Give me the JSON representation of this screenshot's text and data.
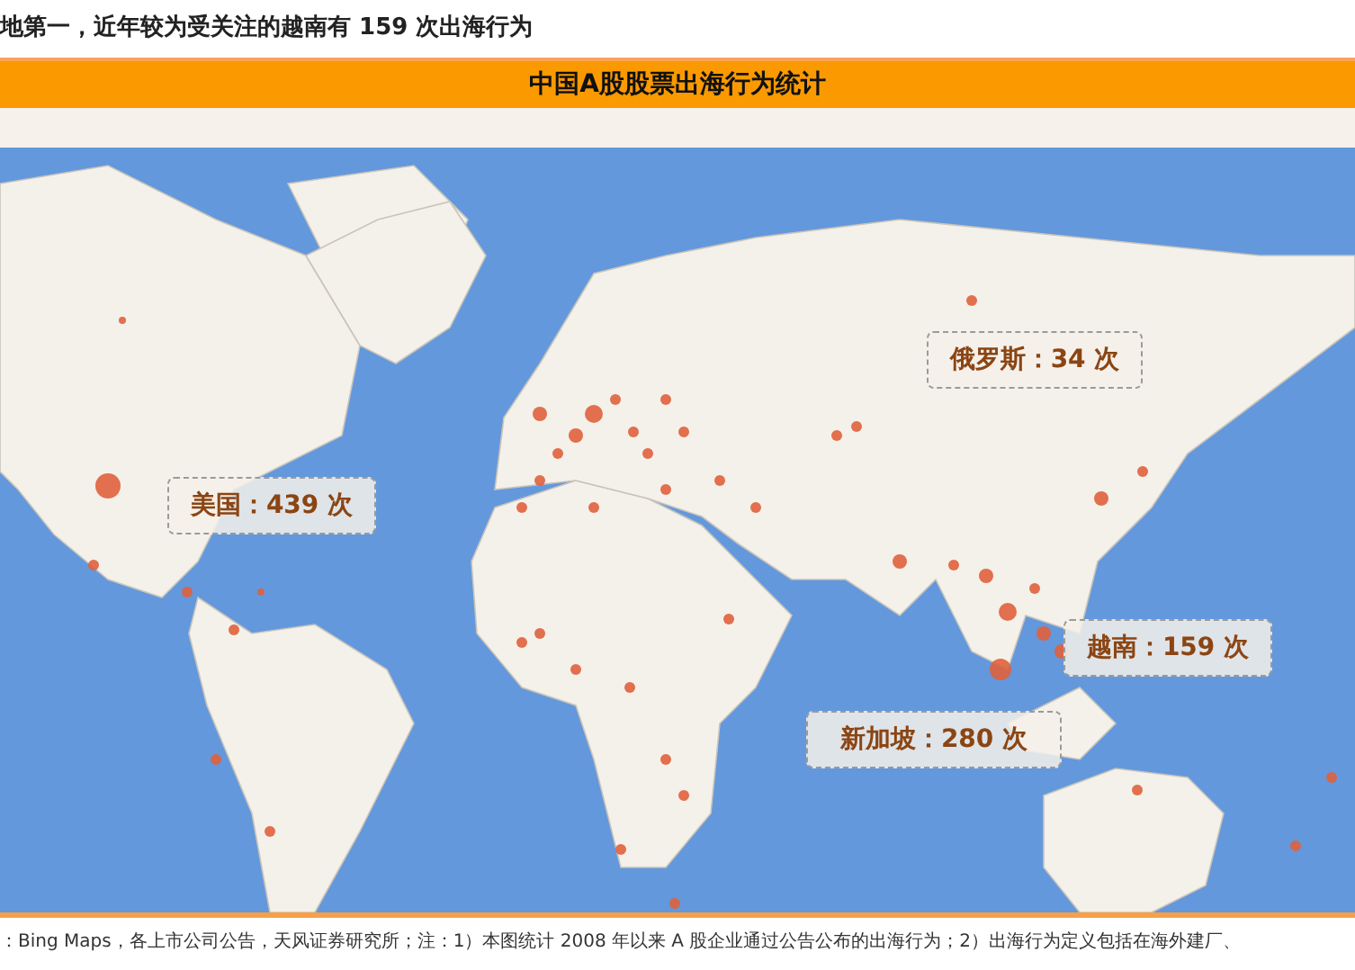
{
  "caption": "地第一，近年较为受关注的越南有 159 次出海行为",
  "title_bar": {
    "title": "中国A股股票出海行为统计"
  },
  "map": {
    "callouts": [
      {
        "label": "美国：439 次"
      },
      {
        "label": "俄罗斯：34 次"
      },
      {
        "label": "越南：159 次"
      },
      {
        "label": "新加坡：280 次"
      }
    ]
  },
  "source": "：Bing Maps，各上市公司公告，天风证券研究所；注：1）本图统计 2008 年以来 A 股企业通过公告公布的出海行为；2）出海行为定义包括在海外建厂、"
}
